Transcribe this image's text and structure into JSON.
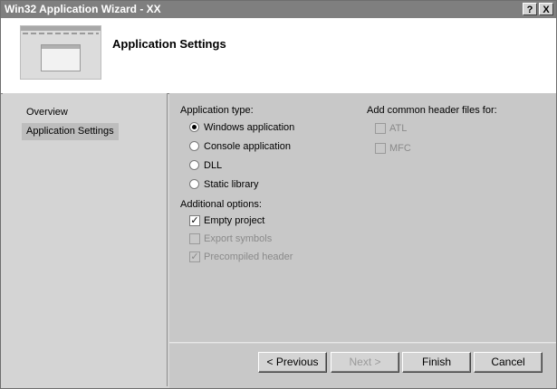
{
  "window": {
    "title": "Win32 Application Wizard - XX",
    "help_label": "?",
    "close_label": "X"
  },
  "header": {
    "title": "Application Settings"
  },
  "sidebar": {
    "items": [
      {
        "label": "Overview",
        "selected": false
      },
      {
        "label": "Application Settings",
        "selected": true
      }
    ]
  },
  "application_type": {
    "label": "Application type:",
    "options": [
      {
        "label": "Windows application",
        "checked": true
      },
      {
        "label": "Console application",
        "checked": false
      },
      {
        "label": "DLL",
        "checked": false
      },
      {
        "label": "Static library",
        "checked": false
      }
    ]
  },
  "additional_options": {
    "label": "Additional options:",
    "options": [
      {
        "label": "Empty project",
        "checked": true,
        "enabled": true
      },
      {
        "label": "Export symbols",
        "checked": false,
        "enabled": false
      },
      {
        "label": "Precompiled header",
        "checked": true,
        "enabled": false
      }
    ]
  },
  "common_headers": {
    "label": "Add common header files for:",
    "options": [
      {
        "label": "ATL",
        "checked": false,
        "enabled": false
      },
      {
        "label": "MFC",
        "checked": false,
        "enabled": false
      }
    ]
  },
  "buttons": {
    "previous": "< Previous",
    "next": "Next >",
    "finish": "Finish",
    "cancel": "Cancel"
  },
  "colors": {
    "title_bar": "#7f7f7f",
    "dialog_face": "#d4d4d4",
    "content_face": "#c8c8c8",
    "selected_nav": "#bdbdbd",
    "disabled_text": "#8a8a8a"
  }
}
